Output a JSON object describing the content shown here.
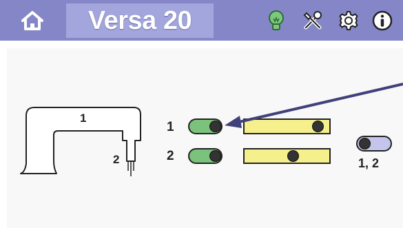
{
  "header": {
    "title": "Versa 20",
    "icons": [
      "home-icon",
      "lightbulb-icon",
      "tools-icon",
      "gear-icon",
      "info-icon"
    ]
  },
  "machine": {
    "head_label": "1",
    "needle_label": "2"
  },
  "needles": [
    {
      "label": "1",
      "toggle_on": true,
      "slider_level": 0.9
    },
    {
      "label": "2",
      "toggle_on": true,
      "slider_level": 0.57
    }
  ],
  "group_toggle": {
    "label": "1, 2",
    "on": false
  },
  "colors": {
    "header_bg": "#8586c8",
    "title_bg": "#a3a6dc",
    "toggle_on": "#7bc27d",
    "toggle_off": "#c4c4ec",
    "slider_fill": "#f5f08c",
    "arrow": "#40417a"
  }
}
